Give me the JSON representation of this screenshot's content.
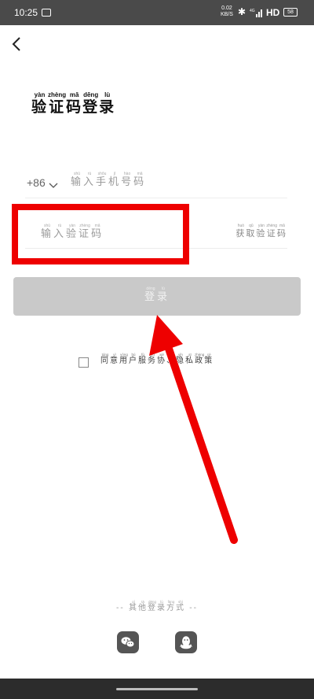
{
  "status_bar": {
    "time": "10:25",
    "net_speed_value": "0.02",
    "net_speed_unit": "KB/S",
    "network": "HD",
    "signal_label": "4G",
    "battery": "58"
  },
  "title": {
    "chars": [
      {
        "char": "验",
        "pinyin": "yàn"
      },
      {
        "char": "证",
        "pinyin": "zhèng"
      },
      {
        "char": "码",
        "pinyin": "mǎ"
      },
      {
        "char": "登",
        "pinyin": "dēng"
      },
      {
        "char": "录",
        "pinyin": "lù"
      }
    ]
  },
  "phone": {
    "country_code": "+86",
    "placeholder": [
      {
        "char": "输",
        "pinyin": "shū"
      },
      {
        "char": "入",
        "pinyin": "rù"
      },
      {
        "char": "手",
        "pinyin": "shǒu"
      },
      {
        "char": "机",
        "pinyin": "jī"
      },
      {
        "char": "号",
        "pinyin": "hào"
      },
      {
        "char": "码",
        "pinyin": "mǎ"
      }
    ]
  },
  "code": {
    "placeholder": [
      {
        "char": "输",
        "pinyin": "shū"
      },
      {
        "char": "入",
        "pinyin": "rù"
      },
      {
        "char": "验",
        "pinyin": "yàn"
      },
      {
        "char": "证",
        "pinyin": "zhèng"
      },
      {
        "char": "码",
        "pinyin": "mǎ"
      }
    ],
    "get_code": [
      {
        "char": "获",
        "pinyin": "huò"
      },
      {
        "char": "取",
        "pinyin": "qǔ"
      },
      {
        "char": "验",
        "pinyin": "yàn"
      },
      {
        "char": "证",
        "pinyin": "zhèng"
      },
      {
        "char": "码",
        "pinyin": "mǎ"
      }
    ]
  },
  "login_button": [
    {
      "char": "登",
      "pinyin": "dēng"
    },
    {
      "char": "录",
      "pinyin": "lù"
    }
  ],
  "agreement": [
    {
      "char": "同",
      "pinyin": "tóng"
    },
    {
      "char": "意",
      "pinyin": "yì"
    },
    {
      "char": "用",
      "pinyin": "yòng"
    },
    {
      "char": "户",
      "pinyin": "hù"
    },
    {
      "char": "服",
      "pinyin": "fú"
    },
    {
      "char": "务",
      "pinyin": "wù"
    },
    {
      "char": "协",
      "pinyin": "xié"
    },
    {
      "char": "、",
      "pinyin": ""
    },
    {
      "char": "隐",
      "pinyin": "yǐn"
    },
    {
      "char": "私",
      "pinyin": "sī"
    },
    {
      "char": "政",
      "pinyin": "zhèng"
    },
    {
      "char": "策",
      "pinyin": "cè"
    }
  ],
  "other_login": {
    "prefix": "--",
    "suffix": "--",
    "chars": [
      {
        "char": "其",
        "pinyin": "qí"
      },
      {
        "char": "他",
        "pinyin": "tā"
      },
      {
        "char": "登",
        "pinyin": "dēng"
      },
      {
        "char": "录",
        "pinyin": "lù"
      },
      {
        "char": "方",
        "pinyin": "fāng"
      },
      {
        "char": "式",
        "pinyin": "shì"
      }
    ]
  },
  "social": {
    "wechat_icon": "wechat-icon",
    "qq_icon": "qq-icon"
  },
  "colors": {
    "annotation_red": "#ee0000",
    "button_disabled": "#c9c9c9"
  }
}
